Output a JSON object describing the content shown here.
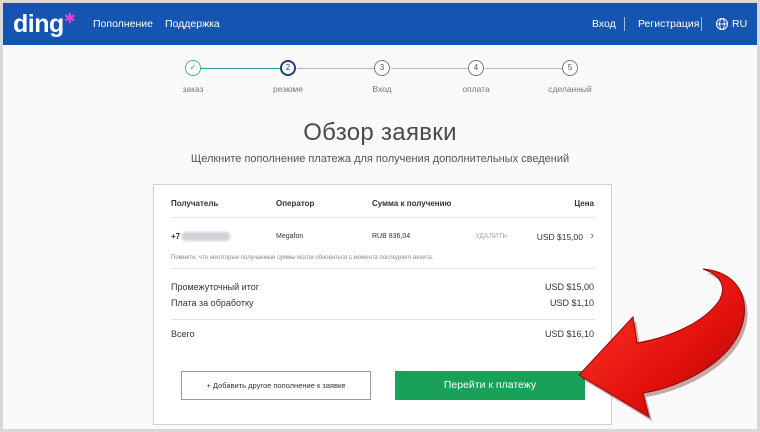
{
  "header": {
    "logo": "ding",
    "nav": [
      "Пополнение",
      "Поддержка"
    ],
    "login": "Вход",
    "register": "Регистрация",
    "language": "RU"
  },
  "steps": [
    {
      "num": "✓",
      "label": "заказ"
    },
    {
      "num": "2",
      "label": "резюме"
    },
    {
      "num": "3",
      "label": "Вход"
    },
    {
      "num": "4",
      "label": "оплата"
    },
    {
      "num": "5",
      "label": "сделанный"
    }
  ],
  "page": {
    "title": "Обзор заявки",
    "subtitle": "Щелкните пополнение платежа для получения дополнительных сведений"
  },
  "table": {
    "headers": {
      "recipient": "Получатель",
      "operator": "Оператор",
      "amount": "Сумма к получению",
      "price": "Цена"
    },
    "row": {
      "phone_prefix": "+7",
      "operator": "Megafon",
      "amount": "RUB 836,04",
      "remove": "УДАЛИТЬ",
      "price": "USD $15,00"
    },
    "note": "Помните, что некоторые получаемые суммы могли обновиться с момента последнего визита."
  },
  "summary": {
    "subtotal_label": "Промежуточный итог",
    "subtotal_value": "USD $15,00",
    "fee_label": "Плата за обработку",
    "fee_value": "USD $1,10",
    "total_label": "Всего",
    "total_value": "USD $16,10"
  },
  "buttons": {
    "add_another": "+ Добавить другое пополнение к заявке",
    "proceed": "Перейти к платежу"
  },
  "colors": {
    "header_bg": "#1554b0",
    "primary_button": "#19a15a",
    "arrow": "#e4100d"
  }
}
